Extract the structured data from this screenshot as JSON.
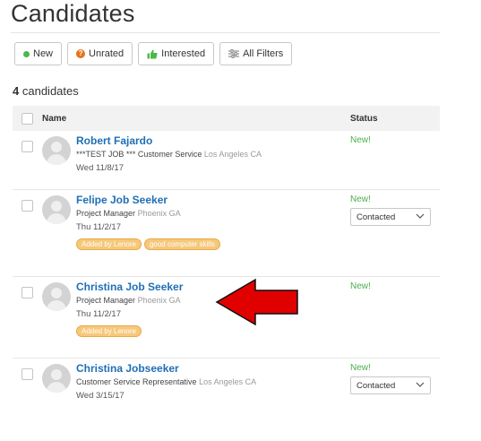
{
  "page": {
    "title": "Candidates"
  },
  "filters": [
    {
      "label": "New",
      "icon": "green-dot-icon"
    },
    {
      "label": "Unrated",
      "icon": "question-circle-icon"
    },
    {
      "label": "Interested",
      "icon": "thumbs-up-icon"
    },
    {
      "label": "All Filters",
      "icon": "sliders-icon"
    }
  ],
  "summary": {
    "count": "4",
    "suffix": "candidates"
  },
  "table": {
    "headers": {
      "name": "Name",
      "status": "Status"
    },
    "rows": [
      {
        "name": "Robert Fajardo",
        "job": "***TEST JOB *** Customer Service",
        "location": "Los Angeles CA",
        "date": "Wed 11/8/17",
        "tags": [],
        "status": "New!",
        "select": null
      },
      {
        "name": "Felipe Job Seeker",
        "job": "Project Manager",
        "location": "Phoenix GA",
        "date": "Thu 11/2/17",
        "tags": [
          "Added by Lenore",
          "good computer skills"
        ],
        "status": "New!",
        "select": "Contacted"
      },
      {
        "name": "Christina Job Seeker",
        "job": "Project Manager",
        "location": "Phoenix GA",
        "date": "Thu 11/2/17",
        "tags": [
          "Added by Lenore"
        ],
        "status": "New!",
        "select": null
      },
      {
        "name": "Christina Jobseeker",
        "job": "Customer Service Representative",
        "location": "Los Angeles CA",
        "date": "Wed 3/15/17",
        "tags": [],
        "status": "New!",
        "select": "Contacted"
      }
    ]
  },
  "colors": {
    "link": "#1f6fb5",
    "status_new": "#4cae4c",
    "tag_bg": "#f6c87a",
    "arrow": "#e00000"
  }
}
